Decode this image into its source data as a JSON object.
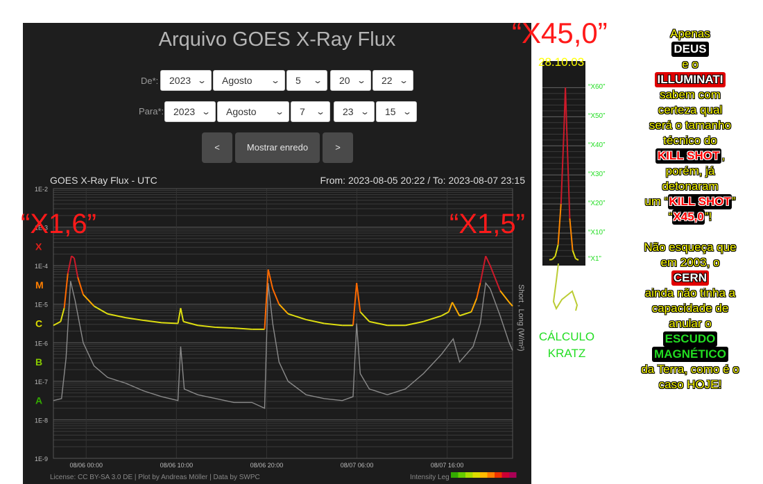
{
  "page": {
    "title": "Arquivo GOES X-Ray Flux"
  },
  "form": {
    "from_label": "De*:",
    "to_label": "Para*:",
    "from": {
      "year": "2023",
      "month": "Agosto",
      "day": "5",
      "hour": "20",
      "minute": "22"
    },
    "to": {
      "year": "2023",
      "month": "Agosto",
      "day": "7",
      "hour": "23",
      "minute": "15"
    },
    "prev_label": "<",
    "show_label": "Mostrar enredo",
    "next_label": ">"
  },
  "chart_data": {
    "type": "line",
    "title": "GOES X-Ray Flux - UTC",
    "range_text": "From: 2023-08-05 20:22  /  To: 2023-08-07 23:15",
    "ylabel": "Short , Long (W/m²)",
    "yscale": "log",
    "ylim": [
      1e-09,
      0.01
    ],
    "ytick_labels": [
      "1E-2",
      "1E-3",
      "1E-4",
      "1E-5",
      "1E-6",
      "1E-7",
      "1E-8",
      "1E-9"
    ],
    "ytick_values": [
      -2,
      -3,
      -4,
      -5,
      -6,
      -7,
      -8,
      -9
    ],
    "class_labels": [
      {
        "label": "X",
        "log": -3.5,
        "color": "#e0201a"
      },
      {
        "label": "M",
        "log": -4.5,
        "color": "#ff7f00"
      },
      {
        "label": "C",
        "log": -5.5,
        "color": "#dddd00"
      },
      {
        "label": "B",
        "log": -6.5,
        "color": "#88cc00"
      },
      {
        "label": "A",
        "log": -7.5,
        "color": "#33aa00"
      }
    ],
    "xlim_hours": [
      0,
      50.88
    ],
    "xtick_labels": [
      "08/06 00:00",
      "08/06 10:00",
      "08/06 20:00",
      "08/07 06:00",
      "08/07 16:00"
    ],
    "xtick_hours": [
      3.63,
      13.63,
      23.63,
      33.63,
      43.63
    ],
    "series": [
      {
        "name": "Long",
        "points": [
          [
            0,
            -5.55
          ],
          [
            0.8,
            -5.45
          ],
          [
            1.2,
            -5.1
          ],
          [
            1.6,
            -4.2
          ],
          [
            2.0,
            -3.75
          ],
          [
            2.3,
            -3.8
          ],
          [
            2.7,
            -4.3
          ],
          [
            3.3,
            -4.75
          ],
          [
            4.5,
            -5.05
          ],
          [
            6,
            -5.25
          ],
          [
            8,
            -5.35
          ],
          [
            10,
            -5.42
          ],
          [
            12,
            -5.48
          ],
          [
            13.8,
            -5.5
          ],
          [
            14.1,
            -5.1
          ],
          [
            14.4,
            -5.45
          ],
          [
            16,
            -5.55
          ],
          [
            18,
            -5.6
          ],
          [
            20,
            -5.62
          ],
          [
            22,
            -5.65
          ],
          [
            23.4,
            -5.65
          ],
          [
            23.8,
            -4.1
          ],
          [
            24.3,
            -4.6
          ],
          [
            25,
            -5.0
          ],
          [
            26,
            -5.25
          ],
          [
            28,
            -5.4
          ],
          [
            30,
            -5.5
          ],
          [
            32,
            -5.55
          ],
          [
            33.2,
            -5.55
          ],
          [
            33.6,
            -4.45
          ],
          [
            34,
            -5.2
          ],
          [
            35,
            -5.45
          ],
          [
            37,
            -5.55
          ],
          [
            39,
            -5.55
          ],
          [
            41,
            -5.45
          ],
          [
            43,
            -5.3
          ],
          [
            43.8,
            -5.2
          ],
          [
            44.2,
            -4.95
          ],
          [
            45,
            -5.3
          ],
          [
            46.3,
            -5.2
          ],
          [
            46.9,
            -4.85
          ],
          [
            47.3,
            -4.45
          ],
          [
            47.9,
            -3.75
          ],
          [
            48.4,
            -4.0
          ],
          [
            49.5,
            -4.65
          ],
          [
            50.5,
            -4.95
          ],
          [
            50.88,
            -5.05
          ]
        ]
      },
      {
        "name": "Short",
        "points": [
          [
            0,
            -7.5
          ],
          [
            0.9,
            -7.45
          ],
          [
            1.4,
            -6.4
          ],
          [
            1.9,
            -4.4
          ],
          [
            2.4,
            -4.9
          ],
          [
            3.3,
            -6.0
          ],
          [
            4.5,
            -6.6
          ],
          [
            6,
            -6.9
          ],
          [
            8,
            -7.05
          ],
          [
            10,
            -7.25
          ],
          [
            12,
            -7.4
          ],
          [
            13.8,
            -7.5
          ],
          [
            14.1,
            -6.1
          ],
          [
            14.5,
            -7.2
          ],
          [
            16,
            -7.35
          ],
          [
            18,
            -7.45
          ],
          [
            20,
            -7.55
          ],
          [
            22,
            -7.55
          ],
          [
            23.4,
            -7.7
          ],
          [
            23.8,
            -4.45
          ],
          [
            24.3,
            -5.5
          ],
          [
            25,
            -6.5
          ],
          [
            26,
            -7.0
          ],
          [
            28,
            -7.35
          ],
          [
            30,
            -7.45
          ],
          [
            32,
            -7.5
          ],
          [
            33.2,
            -7.4
          ],
          [
            33.6,
            -5.5
          ],
          [
            34,
            -6.8
          ],
          [
            35,
            -7.2
          ],
          [
            37,
            -7.35
          ],
          [
            39,
            -7.2
          ],
          [
            41,
            -6.8
          ],
          [
            43,
            -6.3
          ],
          [
            44.3,
            -5.9
          ],
          [
            45,
            -6.5
          ],
          [
            46.5,
            -6.1
          ],
          [
            47.3,
            -5.5
          ],
          [
            47.9,
            -4.45
          ],
          [
            48.4,
            -4.6
          ],
          [
            49.5,
            -5.3
          ],
          [
            50.5,
            -6.0
          ],
          [
            50.88,
            -6.2
          ]
        ]
      }
    ],
    "license": "License: CC BY-SA 3.0 DE | Plot by Andreas Möller | Data by SWPC",
    "intensity_label": "Intensity Leg",
    "intensity_colors": [
      "#33aa00",
      "#66cc00",
      "#aadd00",
      "#dddd00",
      "#ffbb00",
      "#ff7f00",
      "#ee3300",
      "#cc0033",
      "#aa0055"
    ]
  },
  "overlays": {
    "left_flare": "“X1,6”",
    "right_flare": "“X1,5”",
    "big_flare": "“X45,0”",
    "date_2003": "28.10.03",
    "calc_line1": "CÁLCULO",
    "calc_line2": "KRATZ",
    "mini_labels": [
      "“X60”",
      "“X50”",
      "“X40”",
      "“X30”",
      "“X20”",
      "“X10”",
      "“X1”"
    ],
    "mini_levels": [
      60,
      50,
      40,
      30,
      20,
      10,
      1
    ],
    "mini_series": [
      [
        0,
        0.8
      ],
      [
        1,
        0.9
      ],
      [
        2,
        2
      ],
      [
        3,
        6
      ],
      [
        4,
        20
      ],
      [
        5,
        45
      ],
      [
        5.5,
        60
      ],
      [
        6,
        45
      ],
      [
        7,
        15
      ],
      [
        8,
        4
      ],
      [
        9,
        1.2
      ],
      [
        10,
        0.7
      ]
    ]
  },
  "right_text": {
    "l1": "Apenas",
    "l2": "DEUS",
    "l3": "e o",
    "l4": "ILLUMINATI",
    "l5": "sabem com",
    "l6": "certeza qual",
    "l7": "será o tamanho",
    "l8": "técnico do",
    "l9": "KILL SHOT",
    "l9b": ",",
    "l10": "porém, já",
    "l11": "detonaram",
    "l12a": "um “",
    "l12b": "KILL SHOT",
    "l12c": "”",
    "l13a": "“",
    "l13b": "X45,0",
    "l13c": "”!",
    "l14": "Não esqueça que",
    "l15": "em 2003, o",
    "l16": "CERN",
    "l17": "ainda não tinha a",
    "l18": "capacidade de",
    "l19": "anular o",
    "l20": "ESCUDO",
    "l21": "MAGNÉTICO",
    "l22": "da Terra, como é o",
    "l23": "caso HOJE!"
  }
}
